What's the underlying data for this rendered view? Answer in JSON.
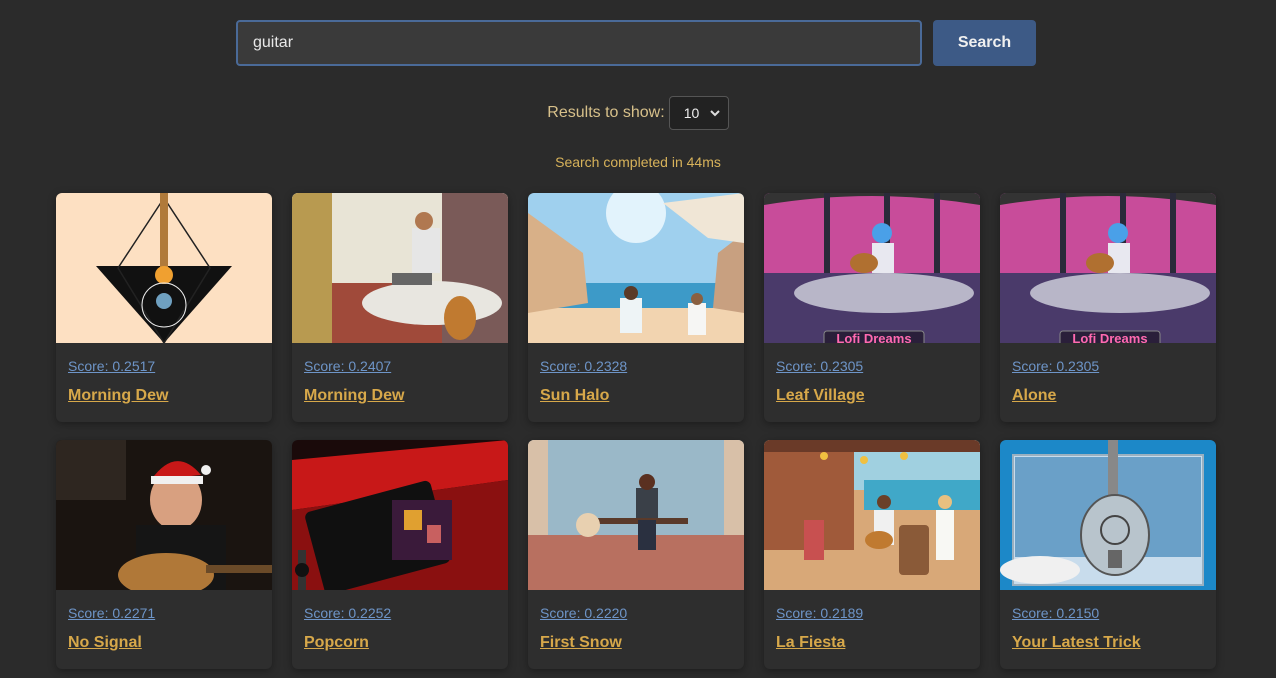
{
  "search": {
    "value": "guitar",
    "button_label": "Search"
  },
  "results_control": {
    "label": "Results to show:",
    "selected": "10"
  },
  "status": "Search completed in 44ms",
  "results": [
    {
      "score": "Score: 0.2517",
      "title": "Morning Dew"
    },
    {
      "score": "Score: 0.2407",
      "title": "Morning Dew"
    },
    {
      "score": "Score: 0.2328",
      "title": "Sun Halo"
    },
    {
      "score": "Score: 0.2305",
      "title": "Leaf Village"
    },
    {
      "score": "Score: 0.2305",
      "title": "Alone"
    },
    {
      "score": "Score: 0.2271",
      "title": "No Signal"
    },
    {
      "score": "Score: 0.2252",
      "title": "Popcorn"
    },
    {
      "score": "Score: 0.2220",
      "title": "First Snow"
    },
    {
      "score": "Score: 0.2189",
      "title": "La Fiesta"
    },
    {
      "score": "Score: 0.2150",
      "title": "Your Latest Trick"
    }
  ],
  "colors": {
    "background": "#2b2b2b",
    "accent": "#3d5a86",
    "title": "#d7a84a",
    "score_link": "#6e95c8"
  }
}
